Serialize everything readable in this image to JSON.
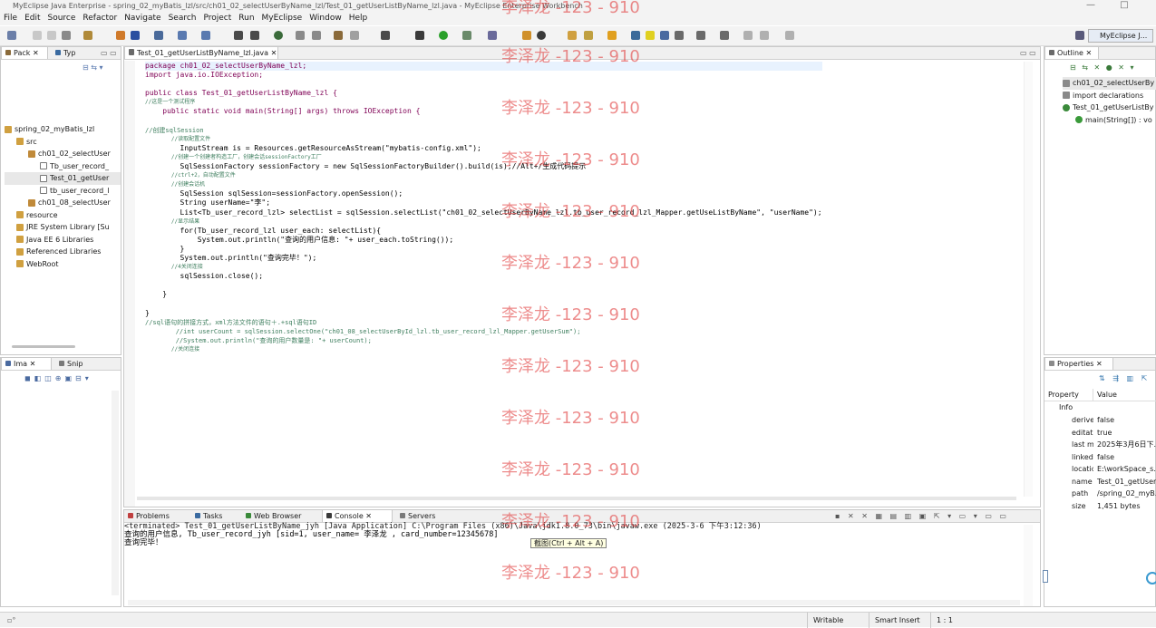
{
  "window": {
    "title": "MyEclipse Java Enterprise - spring_02_myBatis_lzl/src/ch01_02_selectUserByName_lzl/Test_01_getUserListByName_lzl.java - MyEclipse Enterprise Workbench",
    "minimize": "—",
    "maximize": "□",
    "close": "✕"
  },
  "menu": [
    "File",
    "Edit",
    "Source",
    "Refactor",
    "Navigate",
    "Search",
    "Project",
    "Run",
    "MyEclipse",
    "Window",
    "Help"
  ],
  "perspective": "MyEclipse J...",
  "left_panel": {
    "tabs": [
      "Pack",
      "Typ"
    ],
    "tree": [
      {
        "label": "spring_02_myBatis_lzl",
        "level": 0
      },
      {
        "label": "src",
        "level": 1
      },
      {
        "label": "ch01_02_selectUser",
        "level": 2
      },
      {
        "label": "Tb_user_record_",
        "level": 3
      },
      {
        "label": "Test_01_getUser",
        "level": 3
      },
      {
        "label": "tb_user_record_l",
        "level": 3
      },
      {
        "label": "ch01_08_selectUser",
        "level": 2
      },
      {
        "label": "resource",
        "level": 1
      },
      {
        "label": "JRE System Library [Su",
        "level": 1
      },
      {
        "label": "Java EE 6 Libraries",
        "level": 1
      },
      {
        "label": "Referenced Libraries",
        "level": 1
      },
      {
        "label": "WebRoot",
        "level": 1
      }
    ],
    "lower_tabs": [
      "Ima",
      "Snip"
    ]
  },
  "editor": {
    "tab": "Test_01_getUserListByName_lzl.java",
    "lines": [
      {
        "t": "package ch01_02_selectUserByName_lzl;",
        "c": "kwline"
      },
      {
        "t": "import java.io.IOException;",
        "c": "kwline"
      },
      {
        "t": "",
        "c": ""
      },
      {
        "t": "public class Test_01_getUserListByName_lzl {",
        "c": "kwline"
      },
      {
        "t": "//这是一个测试程序",
        "c": "cm"
      },
      {
        "t": "    public static void main(String[] args) throws IOException {",
        "c": "kwline"
      },
      {
        "t": "",
        "c": ""
      },
      {
        "t": "//创建sqlSession",
        "c": "cm2"
      },
      {
        "t": "        //读取配置文件",
        "c": "cm"
      },
      {
        "t": "        InputStream is = Resources.getResourceAsStream(\"mybatis-config.xml\");",
        "c": "code"
      },
      {
        "t": "        //创建一个创建者构造工厂，创建会话sessionFactory工厂",
        "c": "cm"
      },
      {
        "t": "        SqlSessionFactory sessionFactory = new SqlSessionFactoryBuilder().build(is);//Alt+/生成代码提示",
        "c": "code"
      },
      {
        "t": "        //ctrl+2，自动配置文件",
        "c": "cm"
      },
      {
        "t": "        //创建会话机",
        "c": "cm"
      },
      {
        "t": "        SqlSession sqlSession=sessionFactory.openSession();",
        "c": "code"
      },
      {
        "t": "        String userName=\"李\";",
        "c": "code"
      },
      {
        "t": "        List<Tb_user_record_lzl> selectList = sqlSession.selectList(\"ch01_02_selectUserByName_lzl.tb_user_record_lzl_Mapper.getUseListByName\", \"userName\");",
        "c": "code"
      },
      {
        "t": "        //显示结果",
        "c": "cm"
      },
      {
        "t": "        for(Tb_user_record_lzl user_each: selectList){",
        "c": "code"
      },
      {
        "t": "            System.out.println(\"查询的用户信息: \"+ user_each.toString());",
        "c": "code"
      },
      {
        "t": "        }",
        "c": "code"
      },
      {
        "t": "        System.out.println(\"查询完毕！\");",
        "c": "code"
      },
      {
        "t": "        //4关闭连接",
        "c": "cm"
      },
      {
        "t": "        sqlSession.close();",
        "c": "code"
      },
      {
        "t": "",
        "c": ""
      },
      {
        "t": "    }",
        "c": "code"
      },
      {
        "t": "",
        "c": ""
      },
      {
        "t": "}",
        "c": "code"
      },
      {
        "t": "//sql语句的拼接方式，xml方法文件的语句＋.+sql语句ID",
        "c": "cm2"
      },
      {
        "t": "        //int userCount = sqlSession.selectOne(\"ch01_08_selectUserById_lzl.tb_user_record_lzl_Mapper.getUserSum\");",
        "c": "cm2"
      },
      {
        "t": "        //System.out.println(\"查询的用户数量是: \"+ userCount);",
        "c": "cm2"
      },
      {
        "t": "        //关闭连接",
        "c": "cm"
      }
    ]
  },
  "outline": {
    "tab": "Outline",
    "items": [
      {
        "label": "ch01_02_selectUserBy",
        "level": 0
      },
      {
        "label": "import declarations",
        "level": 0
      },
      {
        "label": "Test_01_getUserListBy",
        "level": 0
      },
      {
        "label": "main(String[]) : vo",
        "level": 1
      }
    ]
  },
  "properties": {
    "tab": "Properties",
    "headers": [
      "Property",
      "Value"
    ],
    "group": "Info",
    "rows": [
      {
        "k": "derive",
        "v": "false"
      },
      {
        "k": "editat",
        "v": "true"
      },
      {
        "k": "last m",
        "v": "2025年3月6日下..."
      },
      {
        "k": "linked",
        "v": "false"
      },
      {
        "k": "locatic",
        "v": "E:\\workSpace_s..."
      },
      {
        "k": "name",
        "v": "Test_01_getUser..."
      },
      {
        "k": "path",
        "v": "/spring_02_myB..."
      },
      {
        "k": "size",
        "v": "1,451  bytes"
      }
    ]
  },
  "bottom_panel": {
    "tabs": [
      "Problems",
      "Tasks",
      "Web Browser",
      "Console",
      "Servers"
    ],
    "terminated": "<terminated> Test_01_getUserListByName_jyh [Java Application] C:\\Program Files (x86)\\Java\\jdk1.8.0_73\\bin\\javaw.exe (2025-3-6 下午3:12:36)",
    "out1": "查询的用户信息, Tb_user_record_jyh [sid=1, user_name= 李泽龙 , card_number=12345678]",
    "out2": "查询完毕！",
    "tooltip": "截图(Ctrl + Alt + A)"
  },
  "watermark": "李泽龙 -123 - 910",
  "status": {
    "writable": "Writable",
    "insert": "Smart Insert",
    "pos": "1 : 1"
  }
}
